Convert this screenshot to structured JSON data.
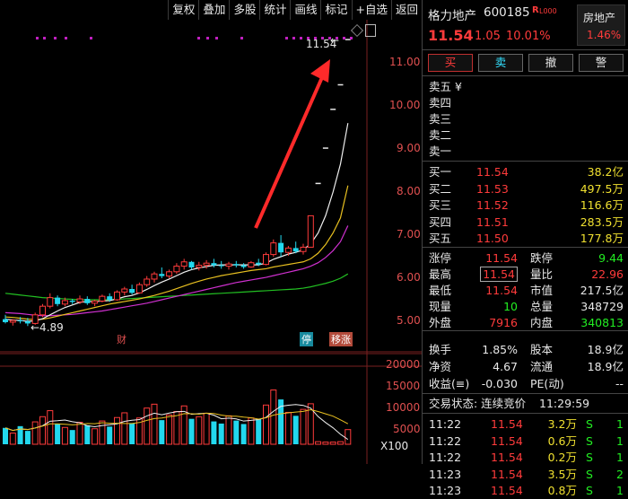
{
  "toolbar": [
    "复权",
    "叠加",
    "多股",
    "统计",
    "画线",
    "标记",
    "+自选",
    "返回"
  ],
  "chart": {
    "price_axis": [
      "11.00",
      "10.00",
      "9.00",
      "8.00",
      "7.00",
      "6.00",
      "5.00"
    ],
    "volume_axis": [
      "20000",
      "15000",
      "10000",
      "5000"
    ],
    "volume_unit": "X100",
    "max_label": "11.54",
    "low_label": "←4.89",
    "event_marks": {
      "cai": "财",
      "ting": "停",
      "yizhang": "移涨"
    }
  },
  "chart_data": {
    "type": "candlestick",
    "price_ylim": [
      4.6,
      11.9
    ],
    "candles": [
      {
        "o": 5.05,
        "h": 5.15,
        "l": 4.95,
        "c": 4.98
      },
      {
        "o": 4.98,
        "h": 5.05,
        "l": 4.9,
        "c": 5.02
      },
      {
        "o": 5.02,
        "h": 5.1,
        "l": 4.95,
        "c": 5.0
      },
      {
        "o": 5.0,
        "h": 5.08,
        "l": 4.89,
        "c": 4.95
      },
      {
        "o": 4.95,
        "h": 5.2,
        "l": 4.92,
        "c": 5.15
      },
      {
        "o": 5.15,
        "h": 5.4,
        "l": 5.1,
        "c": 5.35
      },
      {
        "o": 5.35,
        "h": 5.65,
        "l": 5.3,
        "c": 5.55
      },
      {
        "o": 5.55,
        "h": 5.6,
        "l": 5.35,
        "c": 5.4
      },
      {
        "o": 5.4,
        "h": 5.55,
        "l": 5.35,
        "c": 5.48
      },
      {
        "o": 5.48,
        "h": 5.52,
        "l": 5.4,
        "c": 5.45
      },
      {
        "o": 5.45,
        "h": 5.6,
        "l": 5.4,
        "c": 5.52
      },
      {
        "o": 5.52,
        "h": 5.58,
        "l": 5.38,
        "c": 5.42
      },
      {
        "o": 5.42,
        "h": 5.5,
        "l": 5.35,
        "c": 5.47
      },
      {
        "o": 5.47,
        "h": 5.62,
        "l": 5.44,
        "c": 5.58
      },
      {
        "o": 5.58,
        "h": 5.65,
        "l": 5.45,
        "c": 5.5
      },
      {
        "o": 5.5,
        "h": 5.72,
        "l": 5.48,
        "c": 5.68
      },
      {
        "o": 5.68,
        "h": 5.8,
        "l": 5.6,
        "c": 5.75
      },
      {
        "o": 5.75,
        "h": 5.85,
        "l": 5.62,
        "c": 5.66
      },
      {
        "o": 5.66,
        "h": 5.9,
        "l": 5.64,
        "c": 5.85
      },
      {
        "o": 5.85,
        "h": 6.05,
        "l": 5.8,
        "c": 5.98
      },
      {
        "o": 5.98,
        "h": 6.15,
        "l": 5.9,
        "c": 6.1
      },
      {
        "o": 6.1,
        "h": 6.25,
        "l": 6.0,
        "c": 6.05
      },
      {
        "o": 6.05,
        "h": 6.2,
        "l": 6.0,
        "c": 6.15
      },
      {
        "o": 6.15,
        "h": 6.35,
        "l": 6.1,
        "c": 6.28
      },
      {
        "o": 6.28,
        "h": 6.45,
        "l": 6.2,
        "c": 6.38
      },
      {
        "o": 6.38,
        "h": 6.4,
        "l": 6.2,
        "c": 6.25
      },
      {
        "o": 6.25,
        "h": 6.38,
        "l": 6.18,
        "c": 6.3
      },
      {
        "o": 6.3,
        "h": 6.42,
        "l": 6.22,
        "c": 6.35
      },
      {
        "o": 6.35,
        "h": 6.45,
        "l": 6.25,
        "c": 6.3
      },
      {
        "o": 6.3,
        "h": 6.4,
        "l": 6.22,
        "c": 6.28
      },
      {
        "o": 6.28,
        "h": 6.38,
        "l": 6.2,
        "c": 6.33
      },
      {
        "o": 6.33,
        "h": 6.4,
        "l": 6.25,
        "c": 6.3
      },
      {
        "o": 6.3,
        "h": 6.35,
        "l": 6.22,
        "c": 6.26
      },
      {
        "o": 6.26,
        "h": 6.4,
        "l": 6.24,
        "c": 6.36
      },
      {
        "o": 6.36,
        "h": 6.45,
        "l": 6.28,
        "c": 6.32
      },
      {
        "o": 6.32,
        "h": 6.6,
        "l": 6.3,
        "c": 6.55
      },
      {
        "o": 6.55,
        "h": 6.9,
        "l": 6.5,
        "c": 6.82
      },
      {
        "o": 6.82,
        "h": 7.0,
        "l": 6.5,
        "c": 6.6
      },
      {
        "o": 6.6,
        "h": 6.75,
        "l": 6.52,
        "c": 6.7
      },
      {
        "o": 6.7,
        "h": 6.85,
        "l": 6.58,
        "c": 6.62
      },
      {
        "o": 6.62,
        "h": 6.8,
        "l": 6.55,
        "c": 6.72
      },
      {
        "o": 6.72,
        "h": 7.45,
        "l": 6.72,
        "c": 7.45
      },
      {
        "o": 8.2,
        "h": 8.2,
        "l": 8.2,
        "c": 8.2
      },
      {
        "o": 9.02,
        "h": 9.02,
        "l": 9.02,
        "c": 9.02
      },
      {
        "o": 9.92,
        "h": 9.92,
        "l": 9.92,
        "c": 9.92
      },
      {
        "o": 10.49,
        "h": 10.49,
        "l": 10.49,
        "c": 10.49
      },
      {
        "o": 11.54,
        "h": 11.54,
        "l": 11.54,
        "c": 11.54
      }
    ],
    "volumes": [
      3800,
      2600,
      4200,
      3100,
      5200,
      6400,
      7800,
      4800,
      3900,
      3300,
      5100,
      4400,
      3600,
      5400,
      4100,
      6200,
      7300,
      4900,
      6100,
      8400,
      9300,
      5600,
      6800,
      7600,
      8900,
      5900,
      6400,
      7200,
      5300,
      4800,
      6600,
      5500,
      4700,
      6100,
      5800,
      9100,
      12600,
      10400,
      7400,
      6600,
      8100,
      9400,
      600,
      500,
      500,
      600,
      3400
    ],
    "ma_white": [
      5.05,
      5.03,
      5.02,
      5.0,
      5.01,
      5.06,
      5.15,
      5.24,
      5.32,
      5.38,
      5.44,
      5.46,
      5.46,
      5.47,
      5.48,
      5.52,
      5.57,
      5.6,
      5.66,
      5.74,
      5.83,
      5.91,
      5.98,
      6.06,
      6.14,
      6.2,
      6.24,
      6.27,
      6.3,
      6.31,
      6.31,
      6.31,
      6.31,
      6.31,
      6.31,
      6.35,
      6.44,
      6.5,
      6.56,
      6.6,
      6.66,
      6.8,
      7.05,
      7.45,
      8.0,
      8.65,
      9.6
    ],
    "ma_yellow": [
      5.1,
      5.09,
      5.07,
      5.05,
      5.04,
      5.05,
      5.08,
      5.12,
      5.16,
      5.2,
      5.24,
      5.28,
      5.32,
      5.36,
      5.4,
      5.43,
      5.46,
      5.49,
      5.52,
      5.56,
      5.6,
      5.65,
      5.7,
      5.76,
      5.82,
      5.88,
      5.93,
      5.98,
      6.02,
      6.06,
      6.09,
      6.12,
      6.15,
      6.18,
      6.2,
      6.22,
      6.26,
      6.29,
      6.32,
      6.35,
      6.38,
      6.45,
      6.58,
      6.78,
      7.05,
      7.4,
      8.15
    ],
    "ma_magenta": [
      5.2,
      5.19,
      5.18,
      5.16,
      5.14,
      5.13,
      5.13,
      5.14,
      5.15,
      5.16,
      5.18,
      5.2,
      5.22,
      5.24,
      5.27,
      5.3,
      5.33,
      5.36,
      5.39,
      5.42,
      5.46,
      5.5,
      5.54,
      5.58,
      5.62,
      5.66,
      5.7,
      5.74,
      5.78,
      5.82,
      5.86,
      5.9,
      5.93,
      5.96,
      5.99,
      6.02,
      6.06,
      6.1,
      6.14,
      6.18,
      6.22,
      6.28,
      6.36,
      6.48,
      6.64,
      6.85,
      7.22
    ],
    "ma_green": [
      5.65,
      5.63,
      5.61,
      5.59,
      5.57,
      5.55,
      5.54,
      5.53,
      5.52,
      5.51,
      5.5,
      5.5,
      5.5,
      5.5,
      5.5,
      5.51,
      5.52,
      5.53,
      5.54,
      5.55,
      5.56,
      5.57,
      5.58,
      5.59,
      5.6,
      5.61,
      5.62,
      5.63,
      5.64,
      5.65,
      5.66,
      5.67,
      5.68,
      5.69,
      5.7,
      5.71,
      5.72,
      5.73,
      5.74,
      5.75,
      5.77,
      5.8,
      5.84,
      5.88,
      5.93,
      6.0,
      6.1
    ]
  },
  "quote": {
    "name": "格力地产",
    "code": "600185",
    "tag": "R",
    "tag2": "L000",
    "sector": "房地产",
    "sector_change": "1.46%",
    "price": "11.54",
    "change": "1.05",
    "change_pct": "10.01%",
    "trade_buttons": [
      "买",
      "卖",
      "撤",
      "警"
    ],
    "ask_yuan": "¥",
    "asks": [
      {
        "label": "卖五"
      },
      {
        "label": "卖四"
      },
      {
        "label": "卖三"
      },
      {
        "label": "卖二"
      },
      {
        "label": "卖一"
      }
    ],
    "bids": [
      {
        "label": "买一",
        "price": "11.54",
        "vol": "38.2亿"
      },
      {
        "label": "买二",
        "price": "11.53",
        "vol": "497.5万"
      },
      {
        "label": "买三",
        "price": "11.52",
        "vol": "116.6万"
      },
      {
        "label": "买四",
        "price": "11.51",
        "vol": "283.5万"
      },
      {
        "label": "买五",
        "price": "11.50",
        "vol": "177.8万"
      }
    ],
    "stats1": [
      {
        "l1": "涨停",
        "v1": "11.54",
        "l2": "跌停",
        "v2": "9.44"
      },
      {
        "l1": "最高",
        "v1": "11.54",
        "l2": "量比",
        "v2": "22.96"
      },
      {
        "l1": "最低",
        "v1": "11.54",
        "l2": "市值",
        "v2": "217.5亿"
      },
      {
        "l1": "现量",
        "v1": "10",
        "l2": "总量",
        "v2": "348729"
      },
      {
        "l1": "外盘",
        "v1": "7916",
        "l2": "内盘",
        "v2": "340813"
      }
    ],
    "stats2": [
      {
        "l1": "换手",
        "v1": "1.85%",
        "l2": "股本",
        "v2": "18.9亿"
      },
      {
        "l1": "净资",
        "v1": "4.67",
        "l2": "流通",
        "v2": "18.9亿"
      },
      {
        "l1": "收益(≡)",
        "v1": "-0.030",
        "l2": "PE(动)",
        "v2": "--"
      }
    ],
    "status_label": "交易状态: 连续竞价",
    "status_time": "11:29:59",
    "ticks": [
      {
        "t": "11:22",
        "p": "11.54",
        "v": "3.2万",
        "s": "S",
        "n": "1"
      },
      {
        "t": "11:22",
        "p": "11.54",
        "v": "0.6万",
        "s": "S",
        "n": "1"
      },
      {
        "t": "11:22",
        "p": "11.54",
        "v": "0.2万",
        "s": "S",
        "n": "1"
      },
      {
        "t": "11:23",
        "p": "11.54",
        "v": "3.5万",
        "s": "S",
        "n": "2"
      },
      {
        "t": "11:23",
        "p": "11.54",
        "v": "0.8万",
        "s": "S",
        "n": "1"
      }
    ]
  }
}
